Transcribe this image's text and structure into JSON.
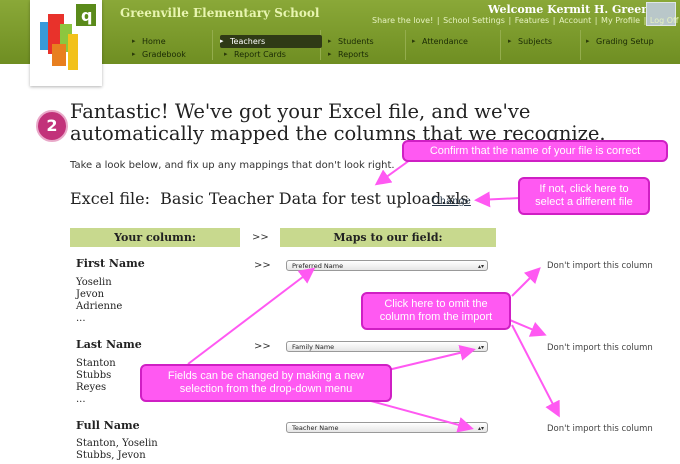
{
  "header": {
    "school_name": "Greenville Elementary School",
    "welcome": "Welcome Kermit H. Green",
    "links": [
      "Share the love!",
      "School Settings",
      "Features",
      "Account",
      "My Profile",
      "Log Off"
    ]
  },
  "nav": {
    "row1": [
      "Home",
      "Teachers",
      "Students",
      "Attendance",
      "Subjects",
      "Grading Setup"
    ],
    "row2": [
      "Gradebook",
      "Report Cards",
      "Reports"
    ],
    "active": "Teachers"
  },
  "step": {
    "number": "2",
    "headline": "Fantastic! We've got your Excel file, and we've automatically mapped the columns that we recognize.",
    "subtext": "Take a look below, and fix up any mappings that don't look right."
  },
  "excel_file": {
    "label": "Excel file:",
    "name": "Basic Teacher Data for test upload.xls",
    "change_link": "Change"
  },
  "table": {
    "col_your": "Your column:",
    "arrow": ">>",
    "col_maps": "Maps to our field:",
    "rows": [
      {
        "name": "First Name",
        "samples": [
          "Yoselin",
          "Jevon",
          "Adrienne",
          "..."
        ],
        "mapped": "Preferred Name",
        "dont_import": "Don't import this column"
      },
      {
        "name": "Last Name",
        "samples": [
          "Stanton",
          "Stubbs",
          "Reyes",
          "..."
        ],
        "mapped": "Family Name",
        "dont_import": "Don't import this column"
      },
      {
        "name": "Full Name",
        "samples": [
          "Stanton, Yoselin",
          "Stubbs, Jevon"
        ],
        "mapped": "Teacher Name",
        "dont_import": "Don't import this column"
      }
    ]
  },
  "callouts": {
    "confirm": "Confirm that the name of your file is correct",
    "change": "If not, click here to select a different file",
    "omit": "Click here to omit the column from the import",
    "fields": "Fields can be changed by making a new selection from the drop-down menu"
  },
  "colors": {
    "header_green": "#7b9a2b",
    "table_header": "#c8d98e",
    "callout_pink": "#ff59f2",
    "step_circle": "#c2327a"
  }
}
